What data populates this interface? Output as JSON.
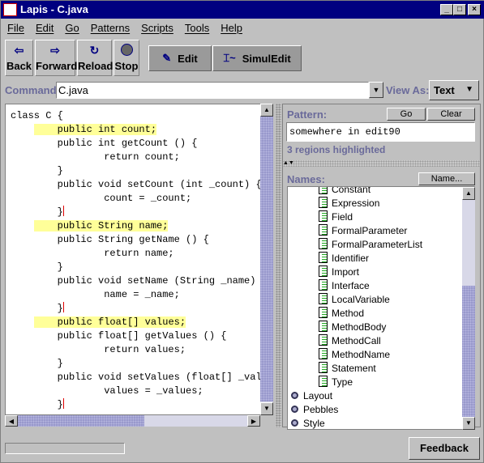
{
  "window": {
    "title": "Lapis - C.java"
  },
  "menu": [
    "File",
    "Edit",
    "Go",
    "Patterns",
    "Scripts",
    "Tools",
    "Help"
  ],
  "toolbar": {
    "back": "Back",
    "forward": "Forward",
    "reload": "Reload",
    "stop": "Stop",
    "edit": "Edit",
    "simuledit": "SimulEdit"
  },
  "command": {
    "label": "Command:",
    "value": "C.java",
    "view_as_label": "View As:",
    "view_as_value": "Text"
  },
  "code": {
    "lines": [
      {
        "t": "class C {",
        "h": false
      },
      {
        "t": "    public int count;",
        "h": true
      },
      {
        "t": "    public int getCount () {",
        "h": false
      },
      {
        "t": "        return count;",
        "h": false
      },
      {
        "t": "    }",
        "h": false
      },
      {
        "t": "    public void setCount (int _count) {",
        "h": false
      },
      {
        "t": "        count = _count;",
        "h": false
      },
      {
        "t": "    }",
        "h": false,
        "c": true
      },
      {
        "t": "    public String name;",
        "h": true
      },
      {
        "t": "    public String getName () {",
        "h": false
      },
      {
        "t": "        return name;",
        "h": false
      },
      {
        "t": "    }",
        "h": false
      },
      {
        "t": "    public void setName (String _name) {",
        "h": false
      },
      {
        "t": "        name = _name;",
        "h": false
      },
      {
        "t": "    }",
        "h": false,
        "c": true
      },
      {
        "t": "    public float[] values;",
        "h": true
      },
      {
        "t": "    public float[] getValues () {",
        "h": false
      },
      {
        "t": "        return values;",
        "h": false
      },
      {
        "t": "    }",
        "h": false
      },
      {
        "t": "    public void setValues (float[] _values)",
        "h": false
      },
      {
        "t": "        values = _values;",
        "h": false
      },
      {
        "t": "    }",
        "h": false,
        "c": true
      }
    ],
    "highlight_color": "#ffff99"
  },
  "pattern": {
    "label": "Pattern:",
    "go": "Go",
    "clear": "Clear",
    "value": "somewhere in edit90",
    "status": "3 regions highlighted"
  },
  "names": {
    "label": "Names:",
    "button": "Name...",
    "children": [
      "Constant",
      "Expression",
      "Field",
      "FormalParameter",
      "FormalParameterList",
      "Identifier",
      "Import",
      "Interface",
      "LocalVariable",
      "Method",
      "MethodBody",
      "MethodCall",
      "MethodName",
      "Statement",
      "Type"
    ],
    "groups": [
      "Layout",
      "Pebbles",
      "Style"
    ]
  },
  "status": {
    "feedback": "Feedback"
  }
}
